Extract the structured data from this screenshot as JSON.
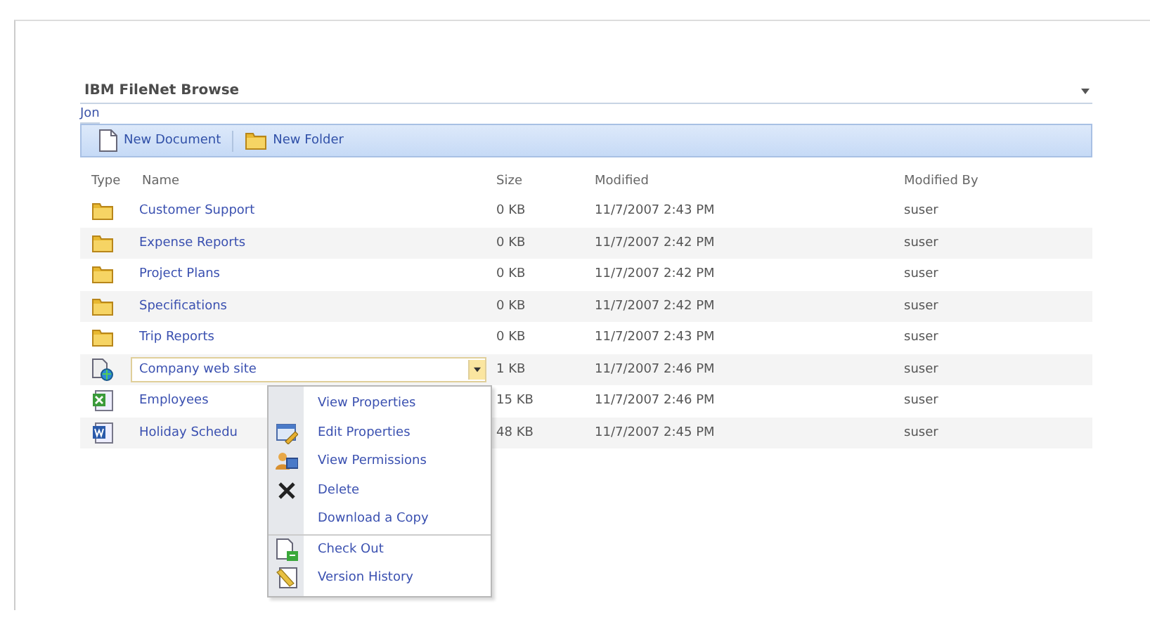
{
  "webpart": {
    "title": "IBM FileNet Browse",
    "breadcrumb": "Jon"
  },
  "toolbar": [
    {
      "kind": "document",
      "label": "New Document"
    },
    {
      "kind": "folder",
      "label": "New Folder"
    }
  ],
  "table": {
    "columns": [
      "Type",
      "Name",
      "Size",
      "Modified",
      "Modified By"
    ],
    "rows": [
      {
        "kind": "folder",
        "name": "Customer Support",
        "size": "0 KB",
        "modified": "11/7/2007 2:43 PM",
        "modified_by": "suser",
        "selected": false
      },
      {
        "kind": "folder",
        "name": "Expense Reports",
        "size": "0 KB",
        "modified": "11/7/2007 2:42 PM",
        "modified_by": "suser",
        "selected": false
      },
      {
        "kind": "folder",
        "name": "Project Plans",
        "size": "0 KB",
        "modified": "11/7/2007 2:42 PM",
        "modified_by": "suser",
        "selected": false
      },
      {
        "kind": "folder",
        "name": "Specifications",
        "size": "0 KB",
        "modified": "11/7/2007 2:42 PM",
        "modified_by": "suser",
        "selected": false
      },
      {
        "kind": "folder",
        "name": "Trip Reports",
        "size": "0 KB",
        "modified": "11/7/2007 2:43 PM",
        "modified_by": "suser",
        "selected": false
      },
      {
        "kind": "webpage",
        "name": "Company web site",
        "size": "1 KB",
        "modified": "11/7/2007 2:46 PM",
        "modified_by": "suser",
        "selected": true
      },
      {
        "kind": "spreadsheet",
        "name": "Employees",
        "size": "15 KB",
        "modified": "11/7/2007 2:46 PM",
        "modified_by": "suser",
        "selected": false
      },
      {
        "kind": "document",
        "name": "Holiday Schedu",
        "size": "48 KB",
        "modified": "11/7/2007 2:45 PM",
        "modified_by": "suser",
        "selected": false
      }
    ]
  },
  "context_menu": {
    "items": [
      {
        "kind": "none",
        "label": "View Properties",
        "group_start": false
      },
      {
        "kind": "edit",
        "label": "Edit Properties",
        "group_start": false
      },
      {
        "kind": "permissions",
        "label": "View Permissions",
        "group_start": false
      },
      {
        "kind": "delete",
        "label": "Delete",
        "group_start": false
      },
      {
        "kind": "none",
        "label": "Download a Copy",
        "group_start": false
      },
      {
        "kind": "checkout",
        "label": "Check Out",
        "group_start": true
      },
      {
        "kind": "history",
        "label": "Version History",
        "group_start": false
      }
    ]
  }
}
